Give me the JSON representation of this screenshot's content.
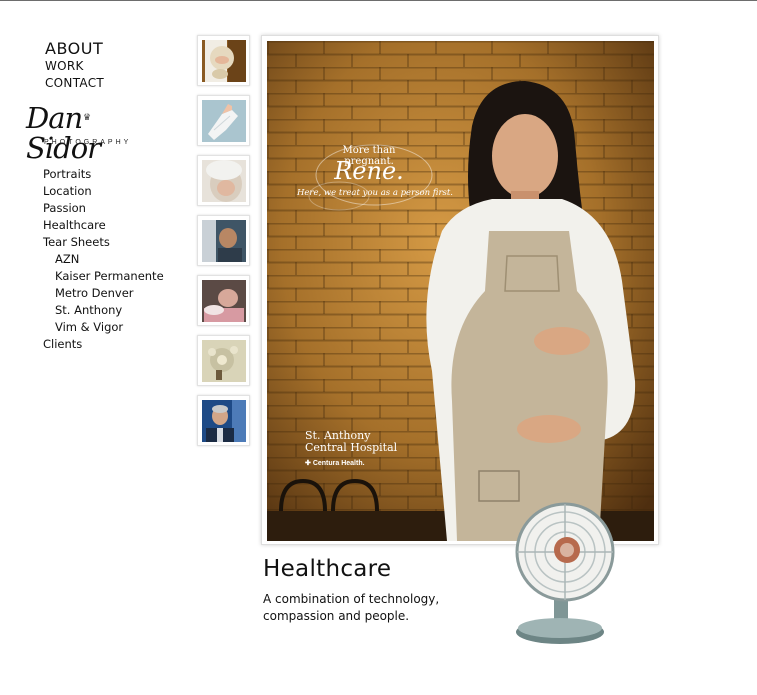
{
  "nav": {
    "about": "ABOUT",
    "work": "WORK",
    "contact": "CONTACT"
  },
  "logo": {
    "name": "Dan Sidor",
    "sub": "PHOTOGRAPHY"
  },
  "categories": {
    "portraits": "Portraits",
    "location": "Location",
    "passion": "Passion",
    "healthcare": "Healthcare",
    "tear_sheets": "Tear Sheets",
    "tear_items": [
      "AZN",
      "Kaiser Permanente",
      "Metro Denver",
      "St. Anthony",
      "Vim & Vigor"
    ],
    "clients": "Clients"
  },
  "ad": {
    "tagline": "More than pregnant.",
    "name": "Rene.",
    "tagline2": "Here, we treat you as a person first.",
    "hospital_line1": "St. Anthony",
    "hospital_line2": "Central Hospital",
    "brand": "Centura Health."
  },
  "caption": {
    "title": "Healthcare",
    "line1": "A combination of technology,",
    "line2": "compassion and people."
  },
  "colors": {
    "brick": "#a5702a",
    "brick_dark": "#5a3712",
    "fan_metal": "#8fa3a3"
  }
}
